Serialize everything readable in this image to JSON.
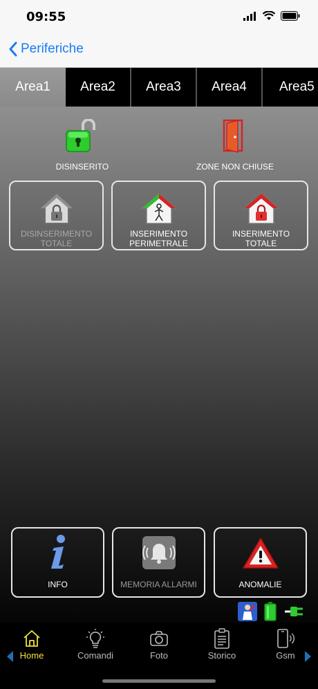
{
  "status_bar": {
    "time": "09:55"
  },
  "nav": {
    "back_label": "Periferiche"
  },
  "tabs": [
    {
      "label": "Area1",
      "active": true
    },
    {
      "label": "Area2",
      "active": false
    },
    {
      "label": "Area3",
      "active": false
    },
    {
      "label": "Area4",
      "active": false
    },
    {
      "label": "Area5",
      "active": false
    }
  ],
  "status": {
    "arm_state": {
      "label": "DISINSERITO",
      "icon": "unlocked-padlock-icon"
    },
    "zones": {
      "label": "ZONE NON CHIUSE",
      "icon": "open-door-icon"
    }
  },
  "arm_buttons": [
    {
      "label_line1": "DISINSERIMENTO",
      "label_line2": "TOTALE",
      "enabled": false,
      "icon": "house-padlock-icon"
    },
    {
      "label_line1": "INSERIMENTO",
      "label_line2": "PERIMETRALE",
      "enabled": true,
      "icon": "house-person-icon"
    },
    {
      "label_line1": "INSERIMENTO",
      "label_line2": "TOTALE",
      "enabled": true,
      "icon": "house-red-lock-icon"
    }
  ],
  "bottom_buttons": [
    {
      "label": "INFO",
      "enabled": true,
      "icon": "info-icon"
    },
    {
      "label": "MEMORIA ALLARMI",
      "enabled": false,
      "icon": "alarm-bell-icon"
    },
    {
      "label": "ANOMALIE",
      "enabled": true,
      "icon": "warning-triangle-icon"
    }
  ],
  "tabbar": [
    {
      "label": "Home",
      "icon": "home-icon",
      "active": true
    },
    {
      "label": "Comandi",
      "icon": "lightbulb-icon",
      "active": false
    },
    {
      "label": "Foto",
      "icon": "camera-icon",
      "active": false
    },
    {
      "label": "Storico",
      "icon": "clipboard-icon",
      "active": false
    },
    {
      "label": "Gsm",
      "icon": "phone-signal-icon",
      "active": false
    }
  ],
  "colors": {
    "accent_blue": "#1a7cf5",
    "active_tab_text": "#f2e23b",
    "green_lock": "#2ecc2e",
    "red": "#d82323"
  }
}
